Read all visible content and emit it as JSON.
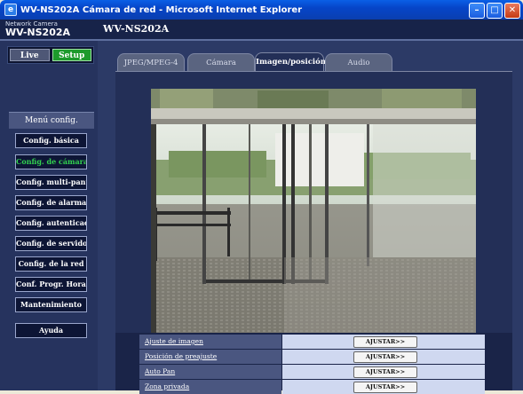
{
  "window": {
    "title": "WV-NS202A Cámara de red - Microsoft Internet Explorer",
    "app_icon": "ie-icon",
    "controls": [
      "minimize-icon",
      "maximize-icon",
      "close-icon"
    ]
  },
  "header": {
    "network_label": "Network Camera",
    "model_left": "WV-NS202A",
    "model_main": "WV-NS202A"
  },
  "mode": {
    "live": "Live",
    "setup": "Setup",
    "active": "Setup"
  },
  "menu": {
    "title": "Menú config.",
    "items": [
      {
        "label": "Config. básica",
        "active": false
      },
      {
        "label": "Config. de cámara",
        "active": true
      },
      {
        "label": "Config. multi-pant.",
        "active": false
      },
      {
        "label": "Config. de alarmas",
        "active": false
      },
      {
        "label": "Config. autenticac.",
        "active": false
      },
      {
        "label": "Config. de servidor",
        "active": false
      },
      {
        "label": "Config. de la red",
        "active": false
      },
      {
        "label": "Conf. Progr. Hora.",
        "active": false
      },
      {
        "label": "Mantenimiento",
        "active": false
      }
    ],
    "help": "Ayuda"
  },
  "tabs": [
    {
      "label": "JPEG/MPEG-4",
      "active": false
    },
    {
      "label": "Cámara",
      "active": false
    },
    {
      "label": "Imagen/posición",
      "active": true
    },
    {
      "label": "Audio",
      "active": false
    }
  ],
  "settings": [
    {
      "label": "Ajuste de imagen",
      "button": "AJUSTAR>>"
    },
    {
      "label": "Posición de preajuste",
      "button": "AJUSTAR>>"
    },
    {
      "label": "Auto Pan",
      "button": "AJUSTAR>>"
    },
    {
      "label": "Zona privada",
      "button": "AJUSTAR>>"
    }
  ],
  "colors": {
    "accent_green": "#1d9a2c",
    "active_menu_text": "#32d14f",
    "background_navy": "#1f2e59"
  }
}
